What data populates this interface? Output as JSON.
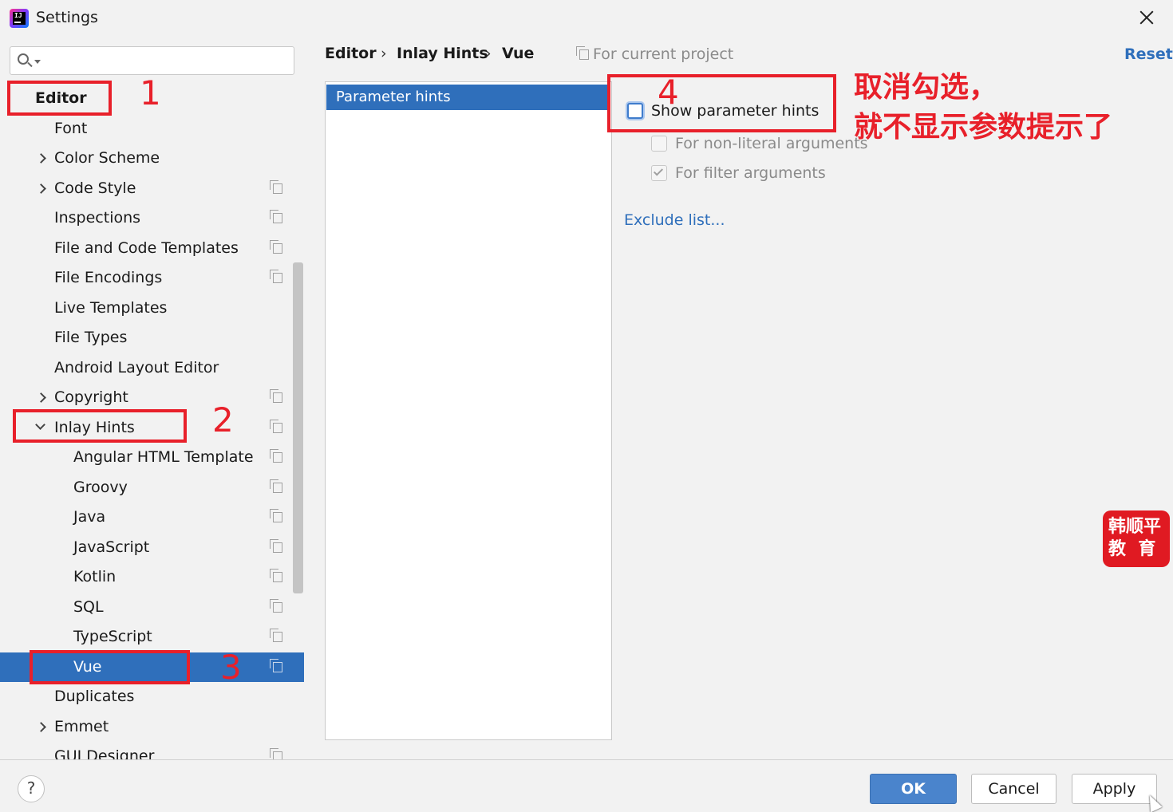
{
  "window": {
    "title": "Settings"
  },
  "sidebar": {
    "search_placeholder": "",
    "items": [
      {
        "label": "Editor",
        "indent": 0,
        "expander": "none",
        "project_icon": false,
        "selected": false,
        "bold": true
      },
      {
        "label": "Font",
        "indent": 1,
        "expander": "none",
        "project_icon": false,
        "selected": false
      },
      {
        "label": "Color Scheme",
        "indent": 1,
        "expander": "right",
        "project_icon": false,
        "selected": false
      },
      {
        "label": "Code Style",
        "indent": 1,
        "expander": "right",
        "project_icon": true,
        "selected": false
      },
      {
        "label": "Inspections",
        "indent": 1,
        "expander": "none",
        "project_icon": true,
        "selected": false
      },
      {
        "label": "File and Code Templates",
        "indent": 1,
        "expander": "none",
        "project_icon": true,
        "selected": false
      },
      {
        "label": "File Encodings",
        "indent": 1,
        "expander": "none",
        "project_icon": true,
        "selected": false
      },
      {
        "label": "Live Templates",
        "indent": 1,
        "expander": "none",
        "project_icon": false,
        "selected": false
      },
      {
        "label": "File Types",
        "indent": 1,
        "expander": "none",
        "project_icon": false,
        "selected": false
      },
      {
        "label": "Android Layout Editor",
        "indent": 1,
        "expander": "none",
        "project_icon": false,
        "selected": false
      },
      {
        "label": "Copyright",
        "indent": 1,
        "expander": "right",
        "project_icon": true,
        "selected": false
      },
      {
        "label": "Inlay Hints",
        "indent": 1,
        "expander": "down",
        "project_icon": true,
        "selected": false
      },
      {
        "label": "Angular HTML Template",
        "indent": 2,
        "expander": "none",
        "project_icon": true,
        "selected": false
      },
      {
        "label": "Groovy",
        "indent": 2,
        "expander": "none",
        "project_icon": true,
        "selected": false
      },
      {
        "label": "Java",
        "indent": 2,
        "expander": "none",
        "project_icon": true,
        "selected": false
      },
      {
        "label": "JavaScript",
        "indent": 2,
        "expander": "none",
        "project_icon": true,
        "selected": false
      },
      {
        "label": "Kotlin",
        "indent": 2,
        "expander": "none",
        "project_icon": true,
        "selected": false
      },
      {
        "label": "SQL",
        "indent": 2,
        "expander": "none",
        "project_icon": true,
        "selected": false
      },
      {
        "label": "TypeScript",
        "indent": 2,
        "expander": "none",
        "project_icon": true,
        "selected": false
      },
      {
        "label": "Vue",
        "indent": 2,
        "expander": "none",
        "project_icon": true,
        "selected": true
      },
      {
        "label": "Duplicates",
        "indent": 1,
        "expander": "none",
        "project_icon": false,
        "selected": false
      },
      {
        "label": "Emmet",
        "indent": 1,
        "expander": "right",
        "project_icon": false,
        "selected": false
      },
      {
        "label": "GUI Designer",
        "indent": 1,
        "expander": "none",
        "project_icon": true,
        "selected": false
      }
    ]
  },
  "breadcrumb": {
    "items": [
      "Editor",
      "Inlay Hints",
      "Vue"
    ],
    "separator": "›"
  },
  "scope_hint": "For current project",
  "reset_label": "Reset",
  "hint_list": {
    "items": [
      "Parameter hints"
    ],
    "selected": "Parameter hints"
  },
  "options": {
    "show_parameter_hints": {
      "label": "Show parameter hints",
      "checked": false
    },
    "non_literal": {
      "label": "For non-literal arguments",
      "checked": false,
      "enabled": false
    },
    "filter_args": {
      "label": "For filter arguments",
      "checked": true,
      "enabled": false
    }
  },
  "exclude_link": "Exclude list...",
  "annotations": {
    "numbers": [
      "1",
      "2",
      "3",
      "4"
    ],
    "note_line1": "取消勾选，",
    "note_line2": "就不显示参数提示了",
    "color": "#e8202a"
  },
  "watermark": {
    "line1": "韩顺平",
    "line2": "教  育"
  },
  "footer": {
    "help": "?",
    "ok": "OK",
    "cancel": "Cancel",
    "apply": "Apply"
  },
  "colors": {
    "accent": "#2f6fbb",
    "selection": "#2f6fbb",
    "ok_button": "#4a84cc"
  }
}
